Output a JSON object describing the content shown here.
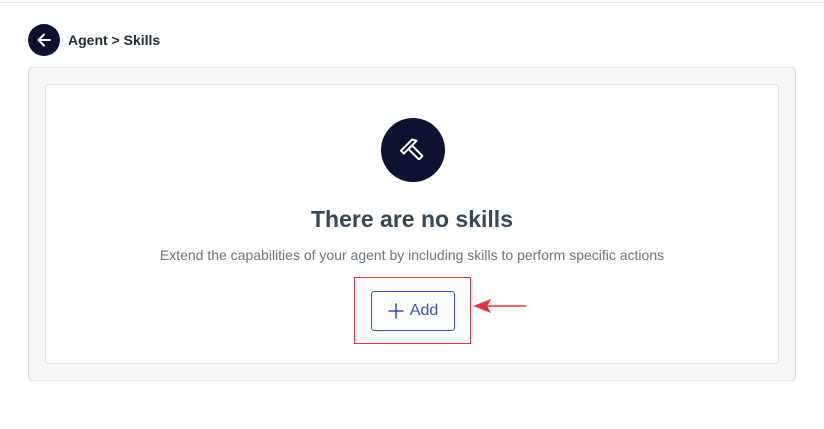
{
  "header": {
    "back_icon": "arrow-left-icon",
    "breadcrumb": "Agent > Skills"
  },
  "empty_state": {
    "icon": "hammer-icon",
    "title": "There are no skills",
    "description": "Extend the capabilities of your agent by including skills to perform specific actions",
    "add_label": "Add",
    "add_icon": "plus-icon"
  },
  "annotation": {
    "color": "#e0383e",
    "arrow_icon": "red-arrow-left-icon"
  },
  "colors": {
    "dark_navy": "#0f1130",
    "accent_blue": "#3d4fc6"
  }
}
